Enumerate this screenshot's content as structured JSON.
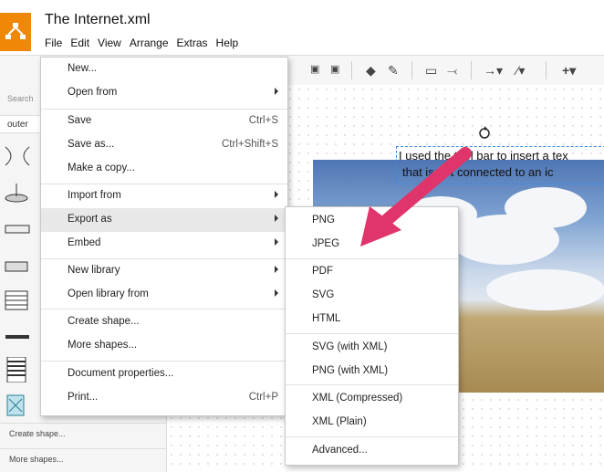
{
  "app": {
    "title": "The Internet.xml",
    "menubar": [
      "File",
      "Edit",
      "View",
      "Arrange",
      "Extras",
      "Help"
    ]
  },
  "left_panel": {
    "search_placeholder": "Search",
    "section": "outer",
    "links": [
      "Create shape...",
      "More shapes..."
    ]
  },
  "canvas": {
    "text_line1": "I used the tool bar to insert a tex",
    "text_line2": "that is not connected to an ic"
  },
  "file_menu": {
    "items": [
      {
        "label": "New...",
        "shortcut": "",
        "arrow": false
      },
      {
        "label": "Open from",
        "shortcut": "",
        "arrow": true
      },
      {
        "label": "Save",
        "shortcut": "Ctrl+S",
        "arrow": false
      },
      {
        "label": "Save as...",
        "shortcut": "Ctrl+Shift+S",
        "arrow": false
      },
      {
        "label": "Make a copy...",
        "shortcut": "",
        "arrow": false
      },
      {
        "label": "Import from",
        "shortcut": "",
        "arrow": true
      },
      {
        "label": "Export as",
        "shortcut": "",
        "arrow": true,
        "highlighted": true
      },
      {
        "label": "Embed",
        "shortcut": "",
        "arrow": true
      },
      {
        "label": "New library",
        "shortcut": "",
        "arrow": true
      },
      {
        "label": "Open library from",
        "shortcut": "",
        "arrow": true
      },
      {
        "label": "Create shape...",
        "shortcut": "",
        "arrow": false
      },
      {
        "label": "More shapes...",
        "shortcut": "",
        "arrow": false
      },
      {
        "label": "Document properties...",
        "shortcut": "",
        "arrow": false
      },
      {
        "label": "Print...",
        "shortcut": "Ctrl+P",
        "arrow": false
      }
    ]
  },
  "export_menu": {
    "items": [
      "PNG",
      "JPEG",
      "PDF",
      "SVG",
      "HTML",
      "SVG (with XML)",
      "PNG (with XML)",
      "XML (Compressed)",
      "XML (Plain)",
      "Advanced..."
    ]
  },
  "colors": {
    "logo": "#f08705",
    "arrow": "#e0356a",
    "selection": "#3a8be8"
  }
}
